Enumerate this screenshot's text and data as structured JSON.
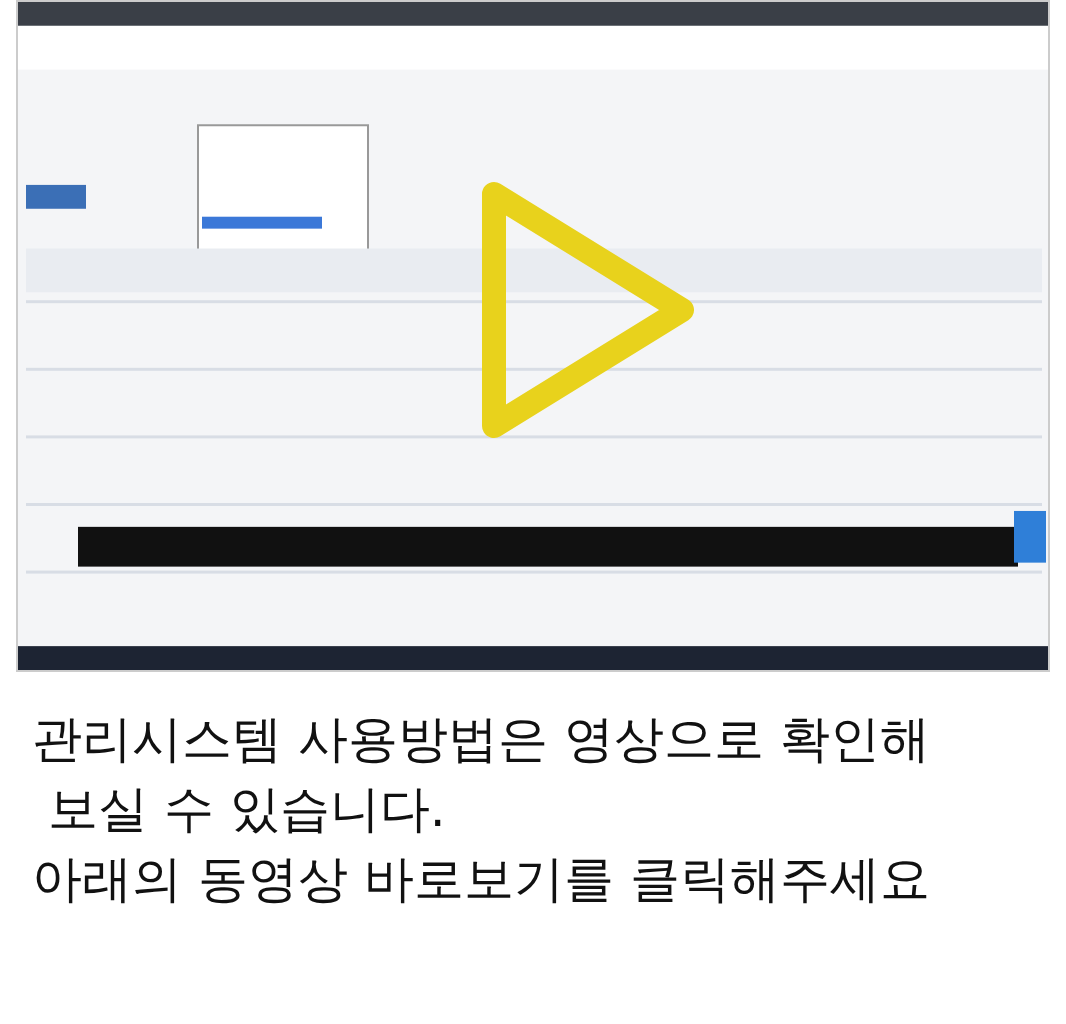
{
  "caption": [
    "관리시스템 사용방법은 영상으로 확인해",
    " 보실 수 있습니다.",
    "아래의 동영상 바로보기를 클릭해주세요"
  ]
}
